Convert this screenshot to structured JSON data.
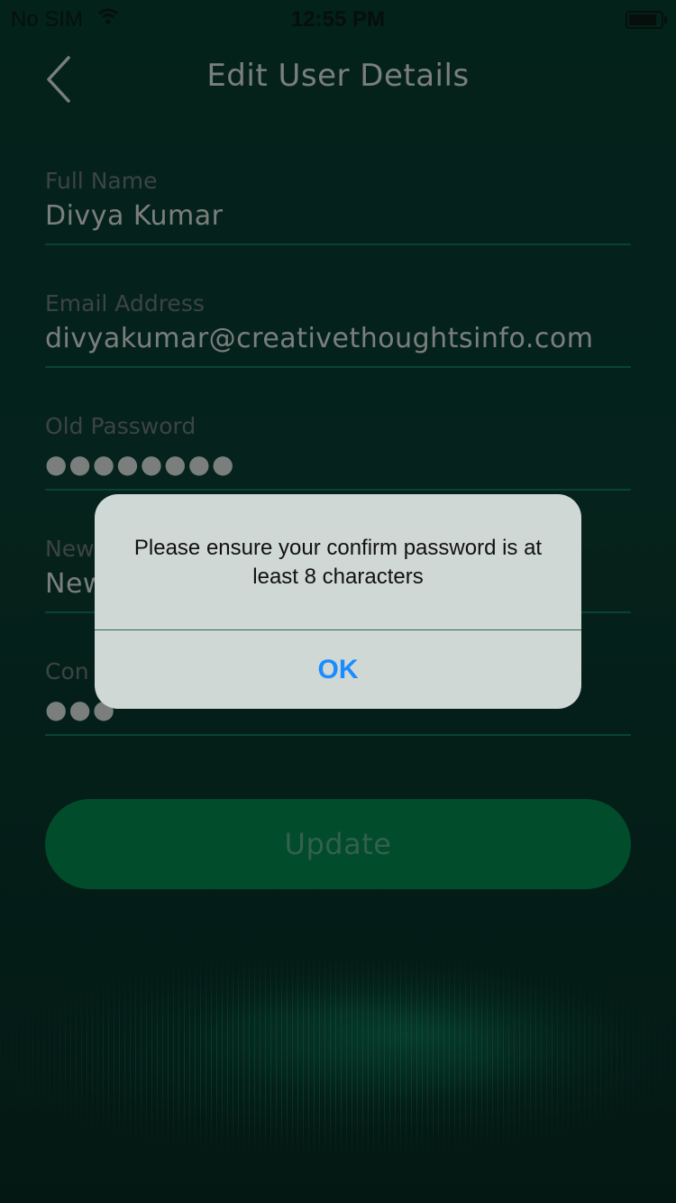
{
  "status_bar": {
    "carrier": "No SIM",
    "time": "12:55 PM"
  },
  "header": {
    "title": "Edit User Details",
    "back_icon": "chevron-left-icon"
  },
  "form": {
    "full_name": {
      "label": "Full Name",
      "value": "Divya Kumar"
    },
    "email": {
      "label": "Email Address",
      "value": "divyakumar@creativethoughtsinfo.com"
    },
    "old_password": {
      "label": "Old Password",
      "value": "●●●●●●●●"
    },
    "new_password": {
      "label": "New",
      "value": "New"
    },
    "confirm_password": {
      "label": "Con",
      "value": "●●●"
    },
    "update_label": "Update"
  },
  "alert": {
    "message": "Please ensure your confirm password is at least 8 characters",
    "ok_label": "OK"
  },
  "colors": {
    "accent": "#028a4d",
    "link": "#1a8cff",
    "underline": "#0f7d5a"
  }
}
